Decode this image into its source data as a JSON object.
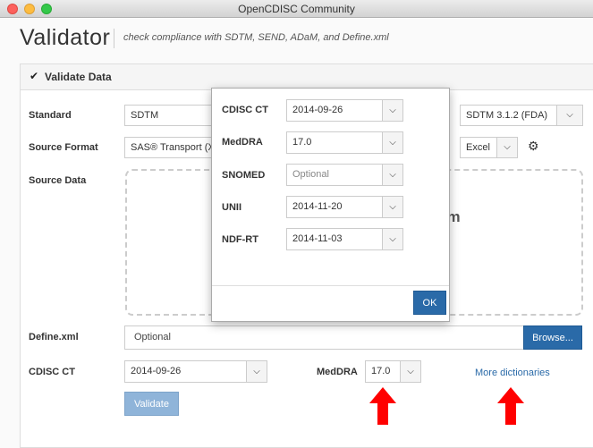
{
  "window": {
    "title": "OpenCDISC Community"
  },
  "header": {
    "app_name": "Validator",
    "tagline": "check compliance with SDTM, SEND, ADaM, and Define.xml"
  },
  "panel": {
    "title": "Validate Data",
    "standard": {
      "label": "Standard",
      "value": "SDTM",
      "version": "SDTM 3.1.2 (FDA)"
    },
    "source_format": {
      "label": "Source Format",
      "value": "SAS® Transport (XP",
      "report_format": "Excel"
    },
    "source_data": {
      "label": "Source Data",
      "drop_text_fragment": "em"
    },
    "define_xml": {
      "label": "Define.xml",
      "placeholder": "Optional",
      "browse_label": "Browse..."
    },
    "cdisc_ct": {
      "label": "CDISC CT",
      "value": "2014-09-26"
    },
    "meddra": {
      "label": "MedDRA",
      "value": "17.0"
    },
    "more_dictionaries": "More dictionaries",
    "validate_label": "Validate"
  },
  "modal": {
    "rows": [
      {
        "label": "CDISC CT",
        "value": "2014-09-26"
      },
      {
        "label": "MedDRA",
        "value": "17.0"
      },
      {
        "label": "SNOMED",
        "value": "Optional"
      },
      {
        "label": "UNII",
        "value": "2014-11-20"
      },
      {
        "label": "NDF-RT",
        "value": "2014-11-03"
      }
    ],
    "ok_label": "OK"
  },
  "icons": {
    "check": "check-icon",
    "gear": "gear-icon",
    "chevron": "chevron-down-icon",
    "arrow": "red-up-arrow-icon"
  },
  "colors": {
    "primary_button": "#2a6aa8",
    "disabled_button": "#8fb4d9",
    "link": "#2a6aa8",
    "arrow": "#ff0000"
  }
}
